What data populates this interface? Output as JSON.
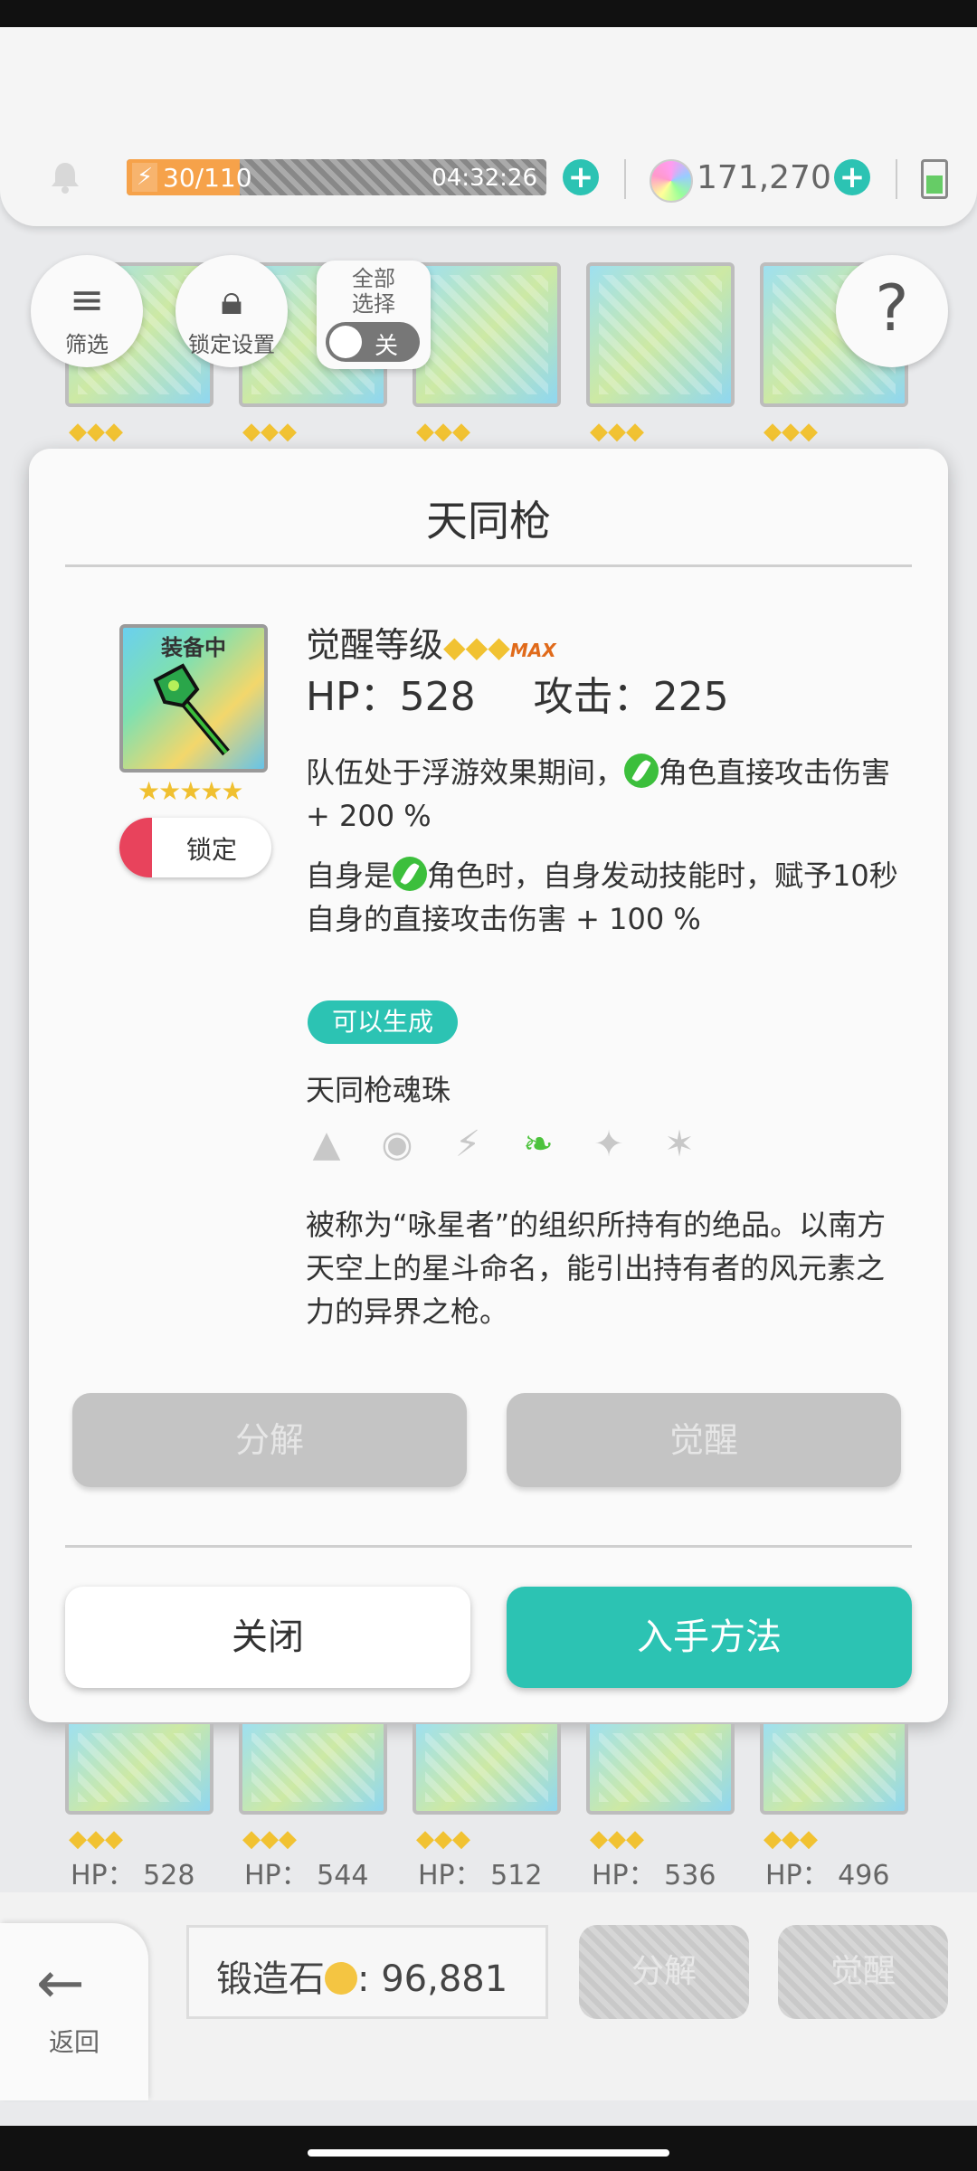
{
  "header": {
    "stamina_value": "30/110",
    "stamina_fraction": 0.27,
    "stamina_timer": "04:32:26",
    "gems": "171,270"
  },
  "toolbar": {
    "filter_label": "筛选",
    "lock_settings_label": "锁定设置",
    "select_all_line1": "全部",
    "select_all_line2": "选择",
    "toggle_state": "关"
  },
  "modal": {
    "title": "天同枪",
    "equipped_tag": "装备中",
    "lock_label": "锁定",
    "awaken_label": "觉醒等级",
    "max_badge": "MAX",
    "hp_label": "HP：",
    "hp_value": "528",
    "atk_label": "攻击：",
    "atk_value": "225",
    "desc1_a": "队伍处于浮游效果期间，",
    "desc1_b": "角色直接攻击伤害 + 200 %",
    "desc2_a": "自身是",
    "desc2_b": "角色时，自身发动技能时，赋予10秒自身的直接攻击伤害 + 100 %",
    "craft_badge": "可以生成",
    "orb_name": "天同枪魂珠",
    "lore": "被称为“咏星者”的组织所持有的绝品。以南方天空上的星斗命名，能引出持有者的风元素之力的异界之枪。",
    "dismantle_label": "分解",
    "awaken_button_label": "觉醒",
    "close_label": "关闭",
    "obtain_label": "入手方法"
  },
  "grid_bottom": {
    "hp_values": [
      "HP： 528",
      "HP： 544",
      "HP： 512",
      "HP： 536",
      "HP： 496"
    ]
  },
  "bottom": {
    "back_label": "返回",
    "forge_label": "锻造石",
    "forge_value": "96,881",
    "dismantle_label": "分解",
    "awaken_label": "觉醒"
  },
  "colors": {
    "accent": "#2cc3b3",
    "lock_red": "#e8435c",
    "wind_green": "#4cc23c"
  }
}
